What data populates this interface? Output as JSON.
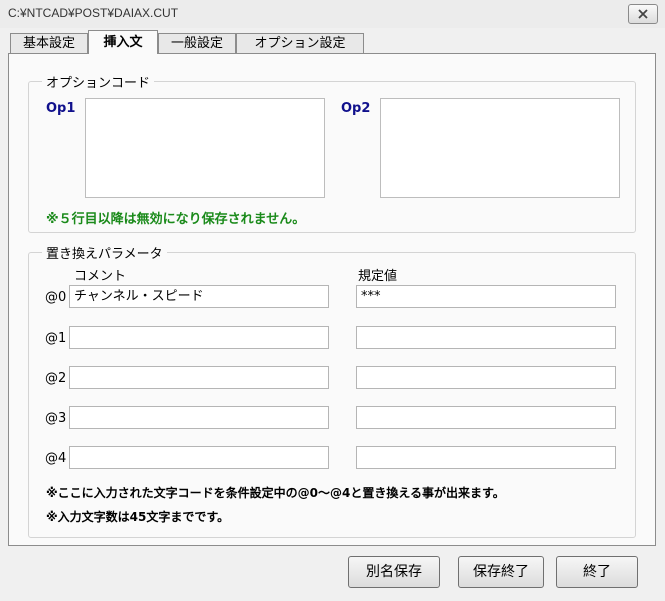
{
  "window": {
    "title": "C:¥NTCAD¥POST¥DAIAX.CUT",
    "close_icon": "close-icon"
  },
  "tabs": [
    "基本設定",
    "挿入文",
    "一般設定",
    "オプション設定"
  ],
  "active_tab": "挿入文",
  "option_group": {
    "legend": "オプションコード",
    "op1_label": "Op1",
    "op1_value": "",
    "op2_label": "Op2",
    "op2_value": "",
    "warning": "※５行目以降は無効になり保存されません。"
  },
  "param_group": {
    "legend": "置き換えパラメータ",
    "col_comment": "コメント",
    "col_default": "規定値",
    "rows": [
      {
        "label": "@0",
        "comment": "チャンネル・スピード",
        "default": "***"
      },
      {
        "label": "@1",
        "comment": "",
        "default": ""
      },
      {
        "label": "@2",
        "comment": "",
        "default": ""
      },
      {
        "label": "@3",
        "comment": "",
        "default": ""
      },
      {
        "label": "@4",
        "comment": "",
        "default": ""
      }
    ],
    "note1": "※ここに入力された文字コードを条件設定中の@0～@4と置き換える事が出来ます。",
    "note2": "※入力文字数は45文字までです。"
  },
  "buttons": {
    "save_as": "別名保存",
    "save_exit": "保存終了",
    "exit": "終了"
  }
}
